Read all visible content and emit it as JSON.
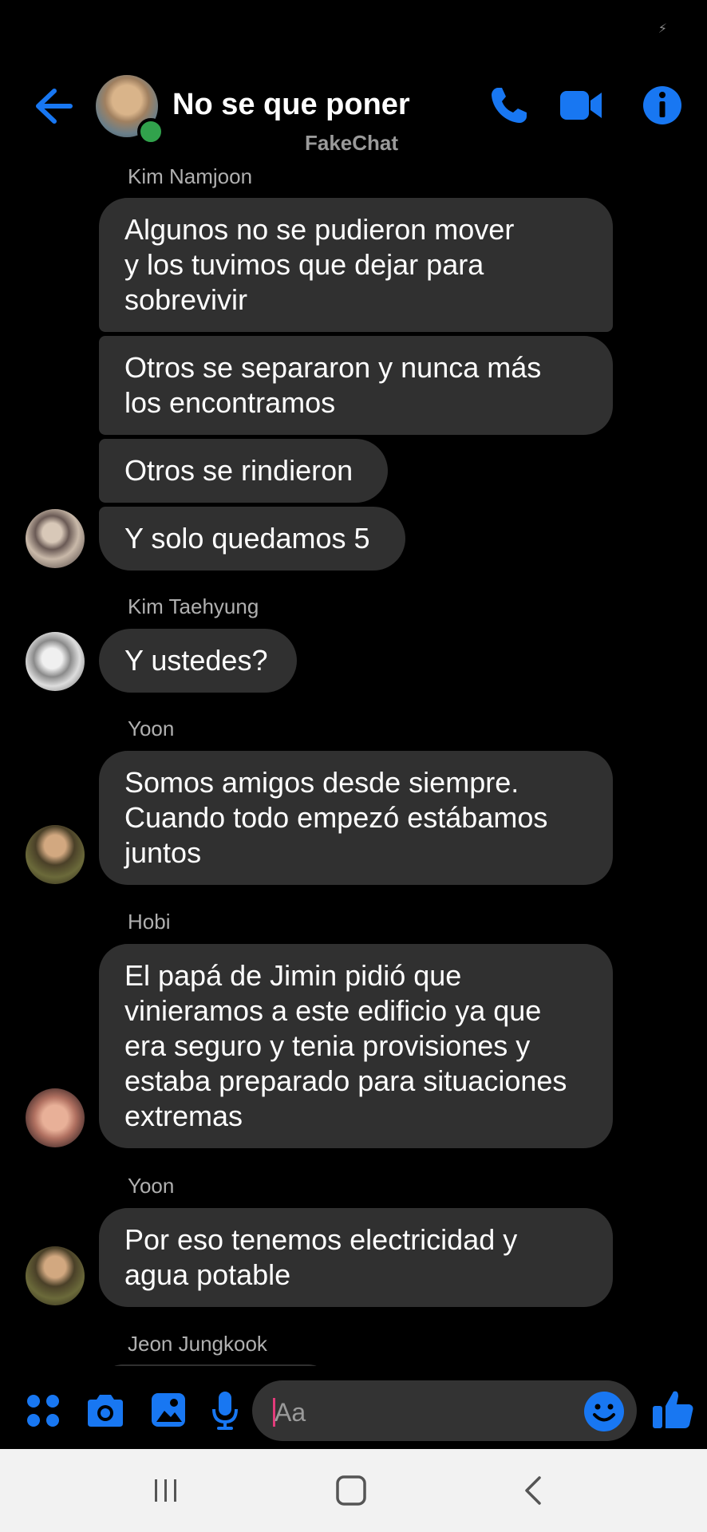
{
  "status": {
    "glyph": "⚡"
  },
  "header": {
    "title": "No se que poner",
    "subtitle": "FakeChat",
    "icons": [
      "back-arrow-icon",
      "phone-icon",
      "video-camera-icon",
      "info-icon"
    ]
  },
  "colors": {
    "accent": "#1877F2",
    "bubble": "#303030",
    "online": "#31A24C",
    "caret": "#E23B7A"
  },
  "messages": [
    {
      "sender": "Kim Namjoon"
    },
    {
      "text": "Algunos no se pudieron mover\ny los tuvimos que dejar para\nsobrevivir"
    },
    {
      "text": "Otros se separaron y nunca más\nlos encontramos"
    },
    {
      "text": "Otros se rindieron"
    },
    {
      "text": "Y solo quedamos 5"
    },
    {
      "sender": "Kim Taehyung"
    },
    {
      "text": "Y ustedes?"
    },
    {
      "sender": "Yoon"
    },
    {
      "text": "Somos amigos desde siempre.\nCuando todo empezó estábamos\njuntos"
    },
    {
      "sender": "Hobi"
    },
    {
      "text": "El papá de Jimin pidió que\nvinieramos a este edificio ya que\nera seguro y tenia provisiones y\nestaba preparado para situaciones\nextremas"
    },
    {
      "sender": "Yoon"
    },
    {
      "text": "Por eso tenemos electricidad y\nagua potable"
    },
    {
      "sender": "Jeon Jungkook"
    }
  ],
  "composer": {
    "placeholder": "Aa",
    "icons": [
      "apps-grid-icon",
      "camera-icon",
      "gallery-icon",
      "microphone-icon",
      "emoji-icon",
      "thumbs-up-icon"
    ]
  },
  "navbar": {
    "icons": [
      "recent-apps-icon",
      "home-icon",
      "back-icon"
    ]
  }
}
